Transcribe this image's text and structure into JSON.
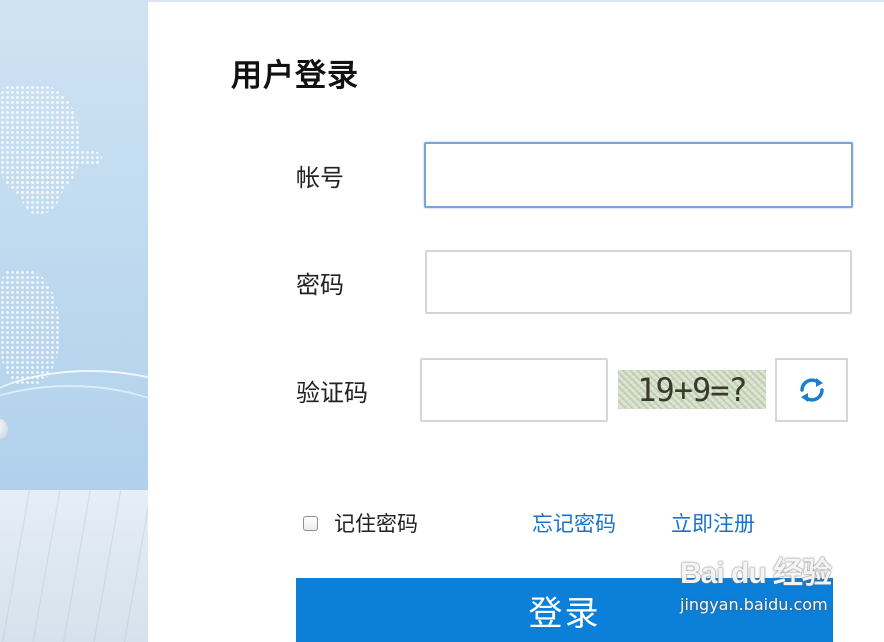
{
  "form": {
    "title": "用户登录",
    "account_label": "帐号",
    "account_value": "",
    "password_label": "密码",
    "password_value": "",
    "captcha_label": "验证码",
    "captcha_value": "",
    "captcha_text": "19+9=?",
    "refresh_icon": "refresh-icon",
    "remember_label": "记住密码",
    "remember_checked": false,
    "forgot_link": "忘记密码",
    "register_link": "立即注册",
    "login_button": "登录"
  },
  "watermark": {
    "logo": "Bai du 经验",
    "url": "jingyan.baidu.com"
  },
  "colors": {
    "accent": "#0c7fd8",
    "link": "#1a73c9",
    "focus_border": "#7da3dc",
    "refresh_icon": "#1a7fd0"
  }
}
